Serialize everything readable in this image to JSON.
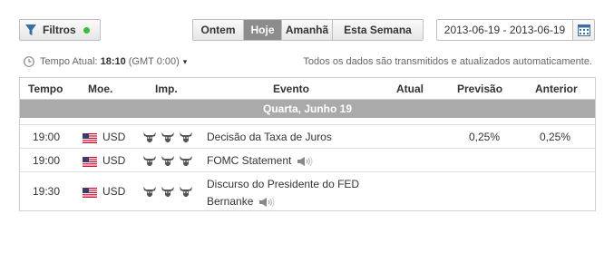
{
  "toolbar": {
    "filters_label": "Filtros",
    "filters_status_color": "#3dbb3d",
    "ranges": [
      {
        "label": "Ontem",
        "active": false
      },
      {
        "label": "Hoje",
        "active": true
      },
      {
        "label": "Amanhã",
        "active": false
      },
      {
        "label": "Esta Semana",
        "active": false
      }
    ],
    "date_range": "2013-06-19 - 2013-06-19"
  },
  "time_info": {
    "label": "Tempo Atual:",
    "time": "18:10",
    "timezone": "(GMT 0:00)",
    "notice": "Todos os dados são transmitidos e atualizados automaticamente."
  },
  "table": {
    "headers": {
      "time": "Tempo",
      "currency": "Moe.",
      "importance": "Imp.",
      "event": "Evento",
      "actual": "Atual",
      "forecast": "Previsão",
      "previous": "Anterior"
    },
    "day_label": "Quarta, Junho 19",
    "rows": [
      {
        "time": "19:00",
        "currency": "USD",
        "flag": "us-flag",
        "importance": 3,
        "event_line1": "Decisão da Taxa de Juros",
        "event_line2": "",
        "has_speech": false,
        "actual": "",
        "forecast": "0,25%",
        "previous": "0,25%"
      },
      {
        "time": "19:00",
        "currency": "USD",
        "flag": "us-flag",
        "importance": 3,
        "event_line1": "FOMC Statement",
        "event_line2": "",
        "has_speech": true,
        "actual": "",
        "forecast": "",
        "previous": ""
      },
      {
        "time": "19:30",
        "currency": "USD",
        "flag": "us-flag",
        "importance": 3,
        "event_line1": "Discurso do Presidente do FED",
        "event_line2": "Bernanke",
        "has_speech": true,
        "actual": "",
        "forecast": "",
        "previous": ""
      }
    ]
  },
  "colors": {
    "active_tab": "#8c8c8c",
    "day_bar": "#aaaaaa",
    "border": "#cfcfcf"
  }
}
